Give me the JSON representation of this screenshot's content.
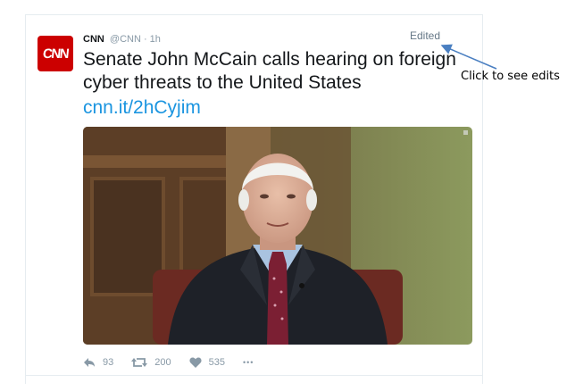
{
  "tweet": {
    "avatar_text": "CNN",
    "display_name": "CNN",
    "handle_time": "@CNN · 1h",
    "text": "Senate John McCain calls hearing on foreign cyber threats to the United States",
    "link": "cnn.it/2hCyjim",
    "edited_label": "Edited",
    "media": {
      "description_icon": "video-still"
    },
    "actions": {
      "reply_count": "93",
      "retweet_count": "200",
      "like_count": "535",
      "more_label": "•••"
    }
  },
  "annotation": {
    "text": "Click to see edits"
  },
  "colors": {
    "brand": "#cc0000",
    "link": "#1b95e0",
    "muted": "#8899a6",
    "text": "#14171a",
    "annotation_arrow": "#4a7fc1"
  }
}
